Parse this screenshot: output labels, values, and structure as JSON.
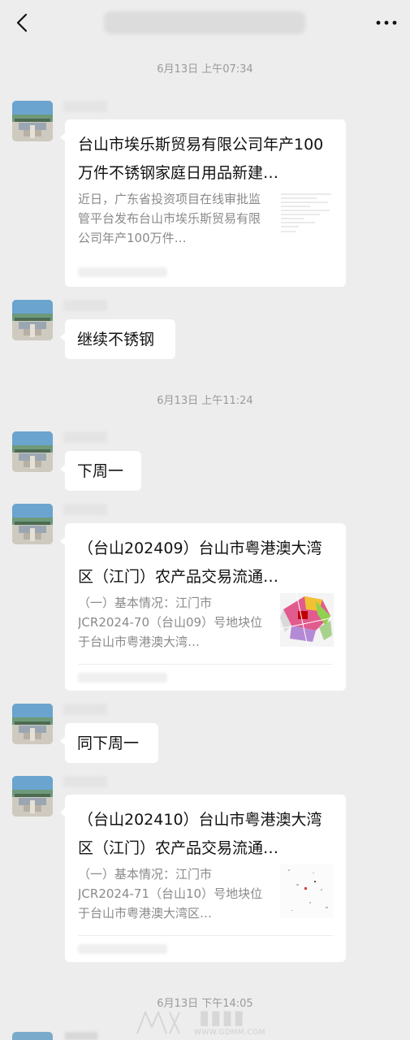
{
  "header": {
    "back_icon": "chevron-left-icon",
    "more_icon": "more-dots-icon"
  },
  "timestamps": [
    "6月13日 上午07:34",
    "6月13日 上午11:24",
    "6月13日 下午14:05"
  ],
  "messages": [
    {
      "type": "card",
      "title": "台山市埃乐斯贸易有限公司年产100万件不锈钢家庭日用品新建…",
      "description": "近日，广东省投资项目在线审批监管平台发布台山市埃乐斯贸易有限公司年产100万件…"
    },
    {
      "type": "text",
      "text": "继续不锈钢"
    },
    {
      "type": "text",
      "text": "下周一"
    },
    {
      "type": "card",
      "title": "（台山202409）台山市粤港澳大湾区（江门）农产品交易流通…",
      "description": "（一）基本情况：江门市JCR2024-70（台山09）号地块位于台山市粤港澳大湾…"
    },
    {
      "type": "text",
      "text": "同下周一"
    },
    {
      "type": "card",
      "title": "（台山202410）台山市粤港澳大湾区（江门）农产品交易流通…",
      "description": "（一）基本情况：江门市JCR2024-71（台山10）号地块位于台山市粤港澳大湾区…"
    }
  ],
  "watermark": {
    "site": "WWW.GDMM.COM"
  }
}
